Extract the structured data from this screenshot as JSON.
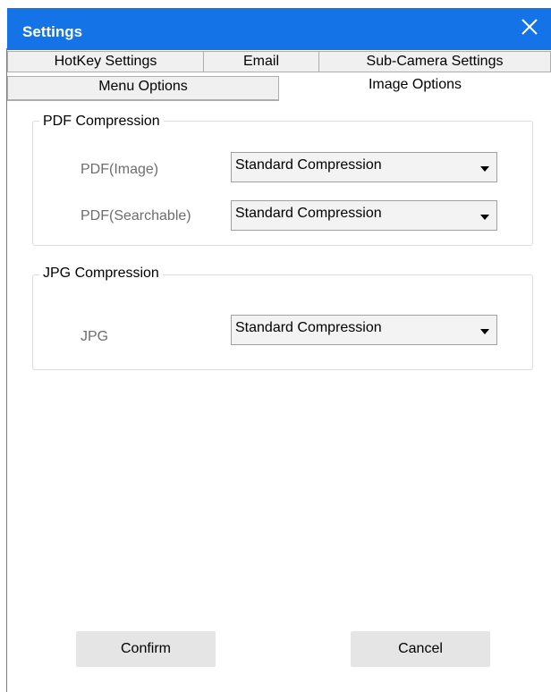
{
  "window": {
    "title": "Settings",
    "title_bar_color": "#1473e6"
  },
  "tabs_row1": [
    {
      "label": "HotKey Settings"
    },
    {
      "label": "Email"
    },
    {
      "label": "Sub-Camera Settings"
    }
  ],
  "tabs_row2": [
    {
      "label": "Menu Options"
    },
    {
      "label": "Image Options",
      "active": true
    }
  ],
  "pdf_group": {
    "legend": "PDF Compression",
    "rows": [
      {
        "label": "PDF(Image)",
        "value": "Standard Compression"
      },
      {
        "label": "PDF(Searchable)",
        "value": "Standard Compression"
      }
    ]
  },
  "jpg_group": {
    "legend": "JPG Compression",
    "rows": [
      {
        "label": "JPG",
        "value": "Standard Compression"
      }
    ]
  },
  "buttons": {
    "confirm": "Confirm",
    "cancel": "Cancel"
  },
  "icons": {
    "close": "close-icon",
    "dropdown": "chevron-down-icon"
  }
}
